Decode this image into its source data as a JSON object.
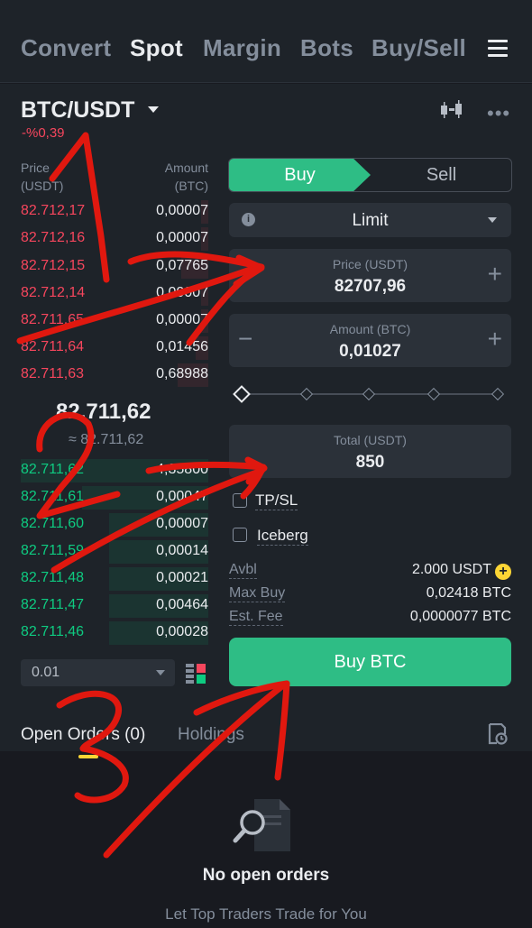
{
  "nav": {
    "tabs": [
      "Convert",
      "Spot",
      "Margin",
      "Bots",
      "Buy/Sell"
    ],
    "active": "Spot"
  },
  "pair": {
    "symbol": "BTC/USDT",
    "change": "-%0,39"
  },
  "orderbook": {
    "price_header": [
      "Price",
      "(USDT)"
    ],
    "amount_header": [
      "Amount",
      "(BTC)"
    ],
    "asks": [
      {
        "price": "82.712,17",
        "amount": "0,00007"
      },
      {
        "price": "82.712,16",
        "amount": "0,00007"
      },
      {
        "price": "82.712,15",
        "amount": "0,07765"
      },
      {
        "price": "82.712,14",
        "amount": "0,00007"
      },
      {
        "price": "82.711,65",
        "amount": "0,00007"
      },
      {
        "price": "82.711,64",
        "amount": "0,01456"
      },
      {
        "price": "82.711,63",
        "amount": "0,68988"
      }
    ],
    "last_price": "82.711,62",
    "last_price_sub": "≈ 82.711,62",
    "bids": [
      {
        "price": "82.711,62",
        "amount": "4,35800"
      },
      {
        "price": "82.711,61",
        "amount": "0,00047"
      },
      {
        "price": "82.711,60",
        "amount": "0,00007"
      },
      {
        "price": "82.711,59",
        "amount": "0,00014"
      },
      {
        "price": "82.711,48",
        "amount": "0,00021"
      },
      {
        "price": "82.711,47",
        "amount": "0,00464"
      },
      {
        "price": "82.711,46",
        "amount": "0,00028"
      }
    ],
    "tick_size": "0.01"
  },
  "order_form": {
    "buy_label": "Buy",
    "sell_label": "Sell",
    "order_type": "Limit",
    "price_label": "Price (USDT)",
    "price_value": "82707,96",
    "amount_label": "Amount (BTC)",
    "amount_value": "0,01027",
    "total_label": "Total (USDT)",
    "total_value": "850",
    "tpsl_label": "TP/SL",
    "iceberg_label": "Iceberg",
    "avbl_label": "Avbl",
    "avbl_value": "2.000 USDT",
    "maxbuy_label": "Max Buy",
    "maxbuy_value": "0,02418 BTC",
    "fee_label": "Est. Fee",
    "fee_value": "0,0000077 BTC",
    "submit_label": "Buy BTC"
  },
  "bottom": {
    "open_orders_tab": "Open Orders (0)",
    "holdings_tab": "Holdings",
    "empty_title": "No open orders",
    "empty_sub": "Let Top Traders Trade for You"
  },
  "annotations": {
    "marks": [
      "1",
      "2",
      "3"
    ]
  },
  "colors": {
    "bg": "#181a20",
    "panel": "#1e2329",
    "input": "#2b3139",
    "buy": "#2ebd85",
    "ask": "#f6465d",
    "bid": "#0ecb81",
    "accent": "#fcd535",
    "annotation": "#e0180f"
  }
}
